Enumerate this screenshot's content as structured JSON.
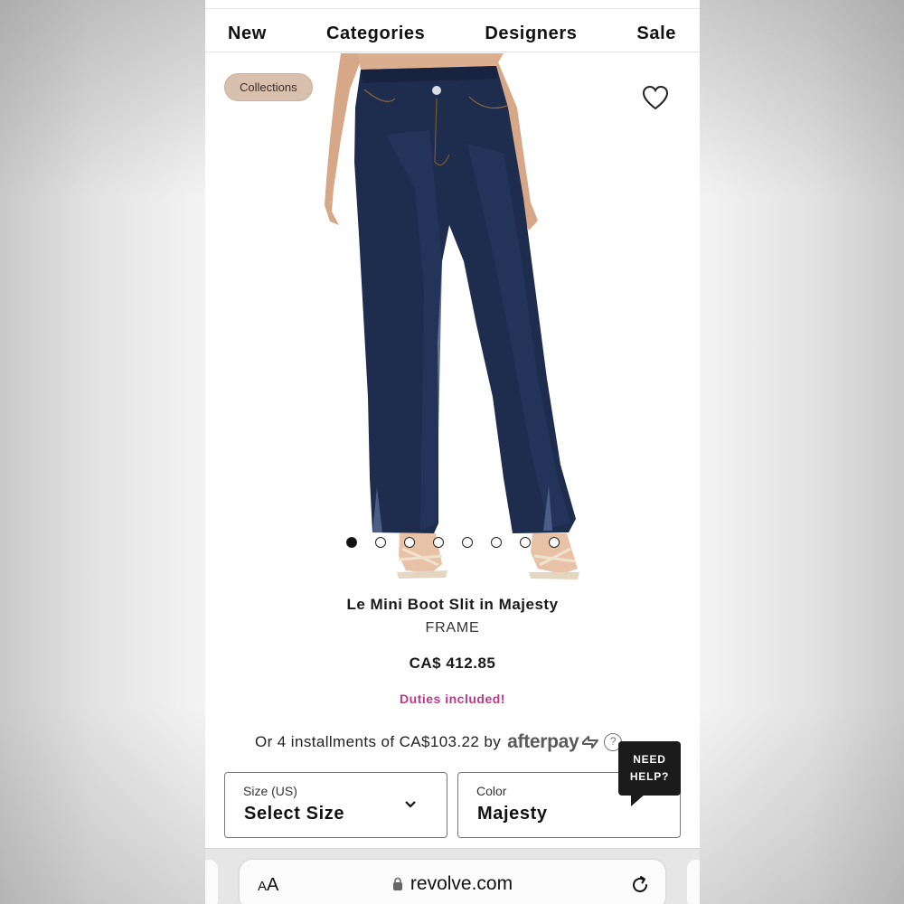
{
  "nav": {
    "items": [
      {
        "label": "New"
      },
      {
        "label": "Categories"
      },
      {
        "label": "Designers"
      },
      {
        "label": "Sale"
      }
    ]
  },
  "hero": {
    "chip_label": "Collections",
    "image_count": 8,
    "active_image": 1
  },
  "product": {
    "name": "Le Mini Boot Slit in Majesty",
    "brand": "FRAME",
    "price": "CA$ 412.85",
    "duties": "Duties included!"
  },
  "installments": {
    "text": "Or 4 installments of CA$103.22 by",
    "provider": "afterpay",
    "info": "?"
  },
  "size_select": {
    "label": "Size (US)",
    "value": "Select Size"
  },
  "color_select": {
    "label": "Color",
    "value": "Majesty"
  },
  "help": {
    "line1": "NEED",
    "line2": "HELP?"
  },
  "browser": {
    "text_size": "AA",
    "url": "revolve.com"
  },
  "colors": {
    "accent_pink": "#c2378b",
    "chip_bg": "#d8bfae",
    "denim": "#1e2c4e"
  }
}
